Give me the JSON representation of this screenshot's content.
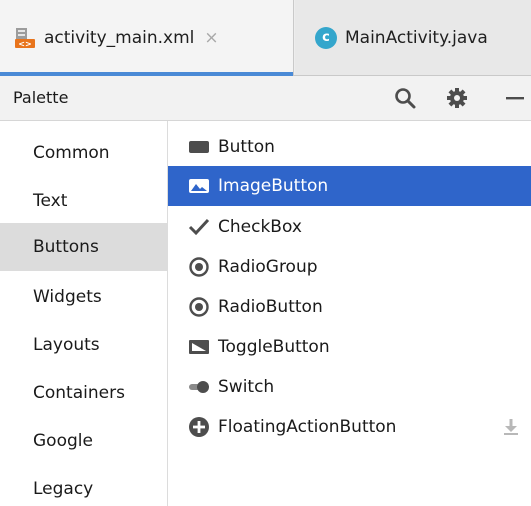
{
  "tabs": [
    {
      "label": "activity_main.xml",
      "icon": "layout-xml-icon",
      "active": true,
      "close": "×"
    },
    {
      "label": "MainActivity.java",
      "icon": "java-class-icon",
      "icon_letter": "c",
      "active": false
    }
  ],
  "palette": {
    "title": "Palette",
    "actions": [
      "search-icon",
      "gear-icon",
      "minimize-icon"
    ]
  },
  "categories": [
    {
      "label": "Common",
      "selected": false
    },
    {
      "label": "Text",
      "selected": false
    },
    {
      "label": "Buttons",
      "selected": true
    },
    {
      "label": "Widgets",
      "selected": false
    },
    {
      "label": "Layouts",
      "selected": false
    },
    {
      "label": "Containers",
      "selected": false
    },
    {
      "label": "Google",
      "selected": false
    },
    {
      "label": "Legacy",
      "selected": false
    }
  ],
  "widgets": [
    {
      "label": "Button",
      "icon": "button-icon",
      "selected": false
    },
    {
      "label": "ImageButton",
      "icon": "image-button-icon",
      "selected": true
    },
    {
      "label": "CheckBox",
      "icon": "checkmark-icon",
      "selected": false
    },
    {
      "label": "RadioGroup",
      "icon": "radio-icon",
      "selected": false
    },
    {
      "label": "RadioButton",
      "icon": "radio-icon",
      "selected": false
    },
    {
      "label": "ToggleButton",
      "icon": "toggle-button-icon",
      "selected": false
    },
    {
      "label": "Switch",
      "icon": "switch-icon",
      "selected": false
    },
    {
      "label": "FloatingActionButton",
      "icon": "plus-circle-icon",
      "selected": false,
      "trailing_icon": "download-icon"
    }
  ],
  "colors": {
    "selection": "#2f65ca",
    "tab_underline": "#4a8ad6",
    "category_selected": "#dcdcdc",
    "icon": "#4d4d4d"
  }
}
